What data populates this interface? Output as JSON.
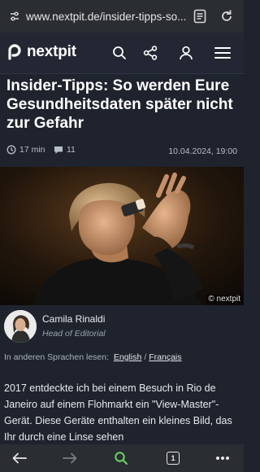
{
  "browser": {
    "url": "www.nextpit.de/insider-tipps-so..."
  },
  "site": {
    "name": "nextpit"
  },
  "article": {
    "title": "Insider-Tipps: So werden Eure Gesundheitsdaten später nicht zur Gefahr",
    "read_time": "17 min",
    "comment_count": "11",
    "date": "10.04.2024, 19:00",
    "image_credit": "© nextpit",
    "author": {
      "name": "Camila Rinaldi",
      "role": "Head of Editorial"
    },
    "languages": {
      "prefix": "In anderen Sprachen lesen:",
      "options": [
        "English",
        "Français"
      ],
      "separator": "/"
    },
    "intro": "2017 entdeckte ich bei einem Besuch in Rio de Janeiro auf einem Flohmarkt ein \"View-Master\"-Gerät. Diese Geräte enthalten ein kleines Bild, das Ihr durch eine Linse sehen"
  },
  "bottom_nav": {
    "tab_count": "1"
  },
  "colors": {
    "page_bg": "#1f232d",
    "browser_bar": "#2a2d31",
    "accent_green": "#6ed36a"
  }
}
